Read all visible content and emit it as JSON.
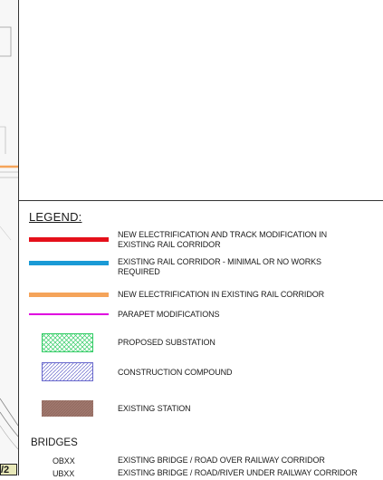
{
  "legend": {
    "title": "LEGEND:",
    "items": [
      {
        "label": "NEW ELECTRIFICATION AND TRACK MODIFICATION IN EXISTING RAIL CORRIDOR",
        "color": "#e5101a",
        "kind": "line"
      },
      {
        "label": "EXISTING RAIL CORRIDOR - MINIMAL OR NO WORKS REQUIRED",
        "color": "#1a9ad6",
        "kind": "line"
      },
      {
        "label": "NEW ELECTRIFICATION IN EXISTING RAIL CORRIDOR",
        "color": "#f5a45a",
        "kind": "line"
      },
      {
        "label": "PARAPET MODIFICATIONS",
        "color": "#e000e0",
        "kind": "thin-line"
      },
      {
        "label": "PROPOSED SUBSTATION",
        "color": "#33cc66",
        "kind": "crosshatch"
      },
      {
        "label": "CONSTRUCTION COMPOUND",
        "color": "#6666cc",
        "kind": "diagonal-hatch"
      },
      {
        "label": "EXISTING STATION",
        "color": "#a0786e",
        "kind": "fill"
      }
    ]
  },
  "bridges": {
    "title": "BRIDGES",
    "rows": [
      {
        "code": "OBXX",
        "label": "EXISTING BRIDGE / ROAD OVER RAILWAY CORRIDOR"
      },
      {
        "code": "UBXX",
        "label": "EXISTING BRIDGE / ROAD/RIVER UNDER RAILWAY CORRIDOR"
      }
    ]
  },
  "sheet_tag": "/2"
}
